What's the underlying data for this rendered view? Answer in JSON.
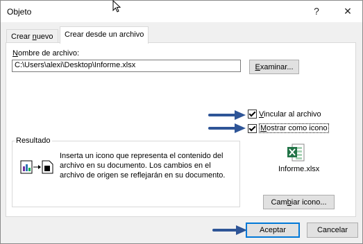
{
  "window": {
    "title": "Objeto",
    "help_label": "?",
    "close_label": "✕"
  },
  "tabs": [
    {
      "label_pre": "Crear ",
      "label_u": "n",
      "label_post": "uevo",
      "active": false
    },
    {
      "label": "Crear desde un archivo",
      "active": true
    }
  ],
  "file": {
    "label_pre": "",
    "label_u": "N",
    "label_post": "ombre de archivo:",
    "value": "C:\\Users\\alexi\\Desktop\\Informe.xlsx",
    "browse_pre": "",
    "browse_u": "E",
    "browse_post": "xaminar..."
  },
  "options": {
    "link_pre": "",
    "link_u": "V",
    "link_post": "incular al archivo",
    "link_checked": true,
    "icon_pre": "",
    "icon_u": "M",
    "icon_post": "ostrar como icono",
    "icon_checked": true
  },
  "file_icon": {
    "icon": "excel-file-icon",
    "label": "Informe.xlsx"
  },
  "change_icon": {
    "pre": "Cam",
    "u": "b",
    "post": "iar icono..."
  },
  "result": {
    "legend": "Resultado",
    "text": "Inserta un icono que representa el contenido del archivo en su documento. Los cambios en el archivo de origen se reflejarán en su documento."
  },
  "footer": {
    "ok": "Aceptar",
    "cancel": "Cancelar"
  },
  "colors": {
    "arrow": "#2e5597",
    "excel_green": "#217346",
    "focus_border": "#0078d7"
  }
}
